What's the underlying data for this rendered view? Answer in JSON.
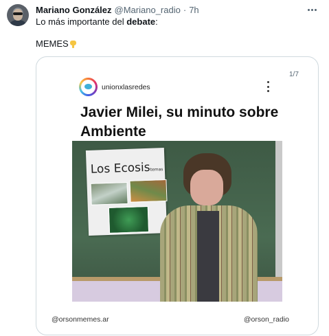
{
  "post": {
    "author_name": "Mariano González",
    "author_handle": "@Mariano_radio",
    "separator": "·",
    "time": "7h",
    "text_line1_prefix": "Lo más importante del ",
    "text_line1_bold": "debate",
    "text_line1_suffix": ":",
    "text_line2": "MEMES",
    "text_line2_emoji": "backhand-index-pointing-down-icon"
  },
  "media": {
    "counter": "1/7",
    "ig_account": "unionxlasredes",
    "meme_title": "Javier Milei, su minuto sobre Ambiente",
    "poster_title_main": "Los Ecosis",
    "poster_title_small": "temas",
    "credit_left": "@orsonmemes.ar",
    "credit_right": "@orson_radio"
  },
  "colors": {
    "text_primary": "#0f1419",
    "text_secondary": "#536471",
    "border": "#cfd9de"
  }
}
